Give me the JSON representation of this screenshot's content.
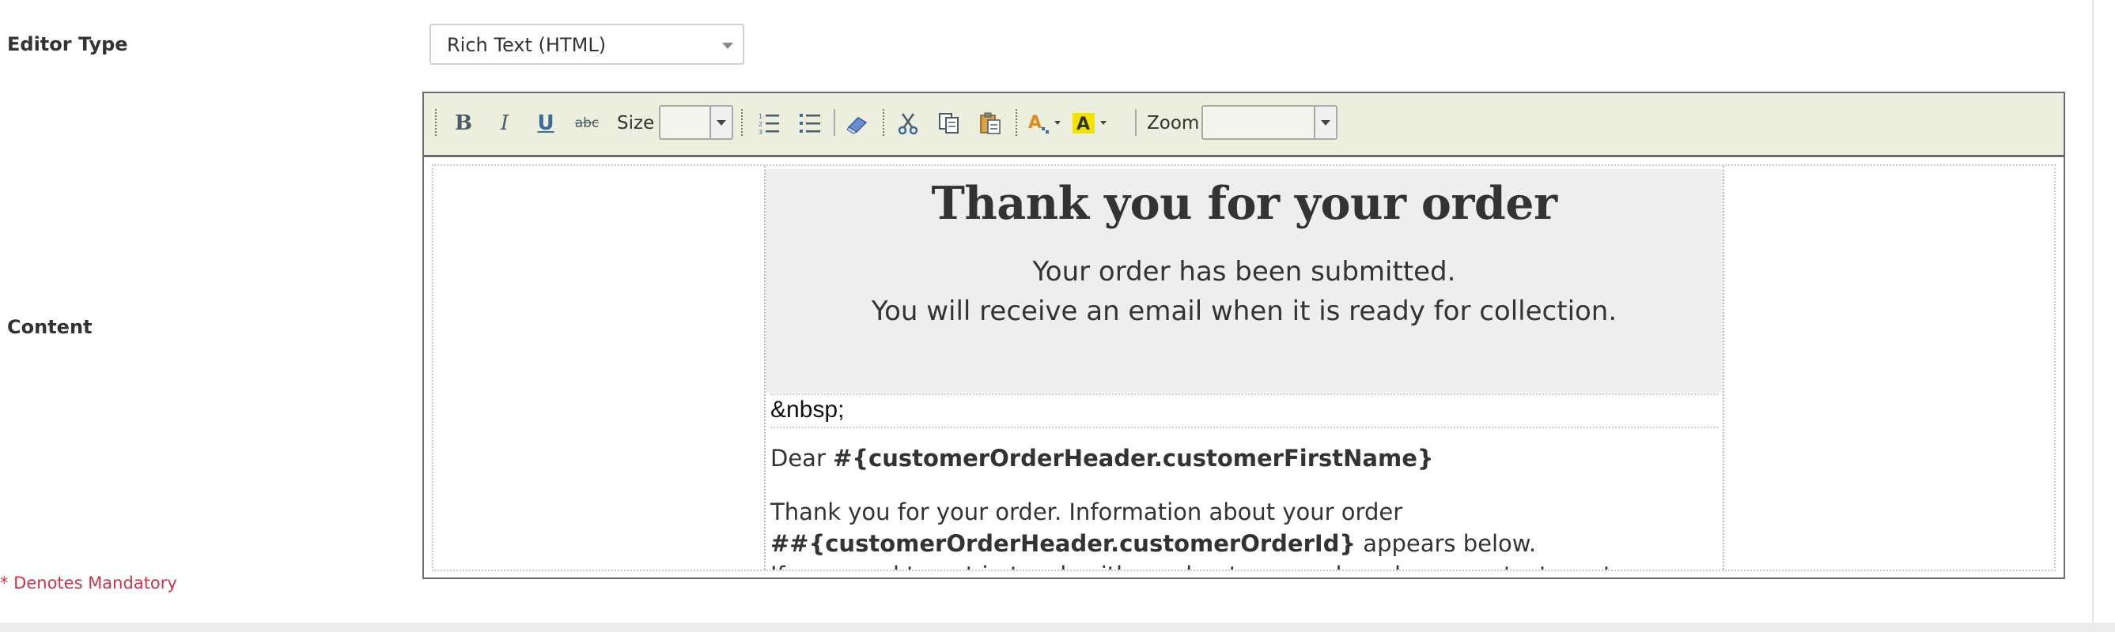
{
  "form": {
    "editor_type_label": "Editor Type",
    "editor_type_value": "Rich Text (HTML)",
    "content_label": "Content",
    "mandatory_note": "* Denotes Mandatory"
  },
  "toolbar": {
    "bold": "B",
    "italic": "I",
    "underline": "U",
    "strike": "abc",
    "size_label": "Size",
    "size_value": "",
    "zoom_label": "Zoom",
    "zoom_value": "",
    "icons": [
      "bold-icon",
      "italic-icon",
      "underline-icon",
      "strikethrough-icon",
      "ordered-list-icon",
      "bullet-list-icon",
      "eraser-icon",
      "cut-icon",
      "copy-icon",
      "paste-icon",
      "font-color-icon",
      "highlight-color-icon"
    ]
  },
  "email": {
    "heading": "Thank you for your order",
    "sub1": "Your order has been submitted.",
    "sub2": "You will receive an email when it is ready for collection.",
    "nbsp": "&nbsp;",
    "dear_prefix": "Dear ",
    "dear_var": "#{customerOrderHeader.customerFirstName}",
    "para1_a": "Thank you for your order. Information about your order",
    "para1_var": "##{customerOrderHeader.customerOrderId}",
    "para1_b": " appears below.",
    "para2_partial": "If you need to get in touch with us about your order, please contact us at"
  },
  "colors": {
    "toolbar_bg": "#ecefdd",
    "mandatory": "#c8354a",
    "banner_bg": "#eeeeec"
  }
}
